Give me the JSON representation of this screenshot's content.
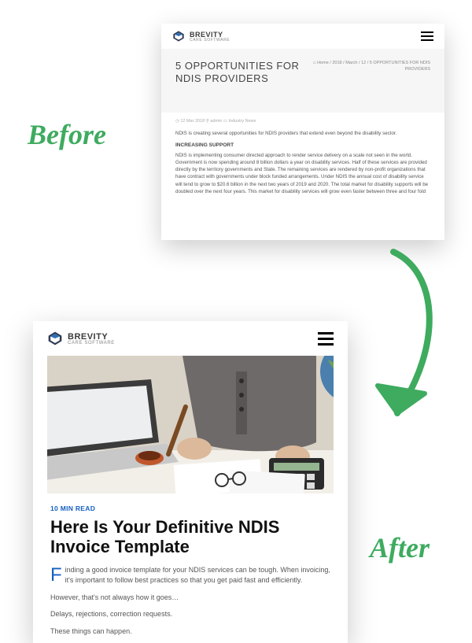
{
  "labels": {
    "before": "Before",
    "after": "After"
  },
  "brand": {
    "name": "BREVITY",
    "tagline": "CARE SOFTWARE"
  },
  "before_card": {
    "title": "5 OPPORTUNITIES FOR NDIS PROVIDERS",
    "breadcrumb": {
      "home": "Home",
      "sep": "/",
      "part2": "2018",
      "part3": "March",
      "part4": "12",
      "current": "5 OPPORTUNITIES FOR NDIS PROVIDERS"
    },
    "meta": "◷ 12 Mar 2018   ⚲ admin   ▭ Industry News",
    "intro": "NDIS is creating several opportunities for NDIS providers that extend even beyond the disability sector.",
    "subheading": "INCREASING SUPPORT",
    "paragraph": "NDIS is implementing consumer directed approach to render service delivery on a scale not seen in the world. Government is now spending around 8 billion dollars a year on disability services. Half of these services are provided directly by the territory governments and State. The remaining services are rendered by non-profit organizations that have contract with governments under block funded arrangements. Under NDIS the annual cost of disability service will tend to grow to $20.6 billion in the next two years of 2019 and 2020. The total market for disability supports will be doubled over the next four years. This market for disability services will grow even faster between three and four fold"
  },
  "after_card": {
    "read_time": "10 MIN READ",
    "title": "Here Is Your Definitive NDIS Invoice Template",
    "dropcap": "F",
    "lead": "inding a good invoice template for your NDIS services can be tough. When invoicing, it's important to follow best practices so that you get paid fast and efficiently.",
    "p2": "However, that's not always how it goes…",
    "p3": "Delays, rejections, correction requests.",
    "p4": "These things can happen."
  },
  "colors": {
    "accent_green": "#3eab5f",
    "link_blue": "#1560c0"
  }
}
